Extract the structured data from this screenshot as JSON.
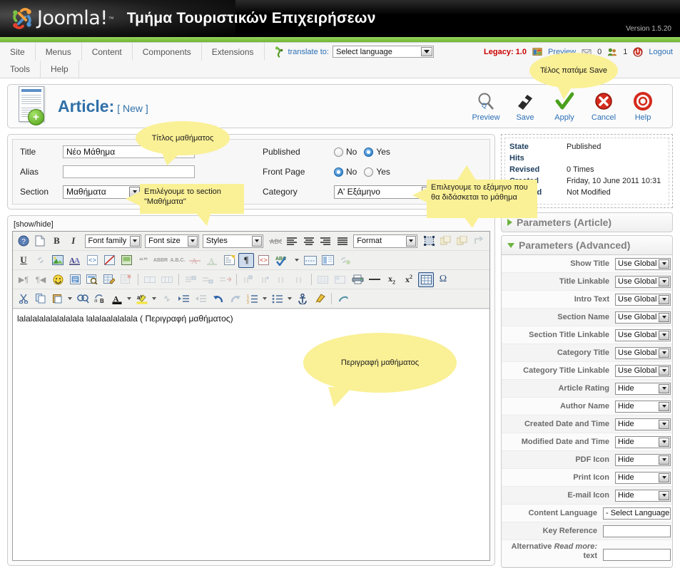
{
  "header": {
    "brand": "Joomla!",
    "brand_tm": "™",
    "site_title": "Τμήμα Τουριστικών Επιχειρήσεων",
    "version": "Version 1.5.20"
  },
  "menubar": {
    "items_row1": [
      "Site",
      "Menus",
      "Content",
      "Components",
      "Extensions"
    ],
    "items_row2": [
      "Tools",
      "Help"
    ],
    "translate_label": "translate to:",
    "translate_value": "Select language",
    "legacy": "Legacy: 1.0",
    "preview": "Preview",
    "messages_count": "0",
    "users_count": "1",
    "logout": "Logout"
  },
  "article": {
    "heading": "Article:",
    "state_tag": "[ New ]",
    "toolbar": [
      {
        "label": "Preview",
        "icon": "magnifier-icon"
      },
      {
        "label": "Save",
        "icon": "floppy-disk-icon"
      },
      {
        "label": "Apply",
        "icon": "checkmark-icon"
      },
      {
        "label": "Cancel",
        "icon": "cancel-circle-icon"
      },
      {
        "label": "Help",
        "icon": "lifering-icon"
      }
    ]
  },
  "form": {
    "title_label": "Title",
    "title_value": "Νέο Μάθημα",
    "alias_label": "Alias",
    "alias_value": "",
    "section_label": "Section",
    "section_value": "Μαθήματα",
    "published_label": "Published",
    "published_no": "No",
    "published_yes": "Yes",
    "published_selected": "Yes",
    "frontpage_label": "Front Page",
    "frontpage_no": "No",
    "frontpage_yes": "Yes",
    "frontpage_selected": "No",
    "category_label": "Category",
    "category_value": "Α' Εξάμηνο"
  },
  "editor": {
    "showhide": "[show/hide]",
    "selects": {
      "font_family": "Font family",
      "font_size": "Font size",
      "styles": "Styles",
      "format": "Format"
    },
    "content": "lalalalalalalalalala lalalaalalalala ( Περιγραφή μαθήματος)",
    "row1_icons": [
      "help-icon",
      "new-document-icon",
      "bold-icon",
      "italic-icon"
    ],
    "row1_icons_after": [
      "strikethrough-icon",
      "align-left-icon",
      "align-center-icon",
      "align-right-icon",
      "align-justify-icon"
    ],
    "row1_tail_icons": [
      "image-placeholder-icon",
      "copy-layer-icon",
      "paste-layer-icon",
      "insert-node-icon"
    ],
    "row2_icons": [
      "underline-icon",
      "unlink-icon",
      "image-tree-icon",
      "font-color-icon",
      "source-code-icon",
      "no-image-icon",
      "readmore-icon",
      "blockquote-icon",
      "abbr-icon",
      "acronym-icon",
      "del-icon",
      "ins-icon",
      "attributes-icon",
      "paragraph-marks-icon",
      "code-red-icon",
      "spellcheck-icon",
      "horizontal-rule-icon",
      "two-columns-icon",
      "anchor-link-icon"
    ],
    "row3_icons": [
      "ltr-icon",
      "rtl-icon",
      "emoticon-icon",
      "media-icon",
      "preview-icon",
      "edit-table-icon",
      "delete-table-icon",
      "merge-cells-icon",
      "split-cells-icon",
      "row-props-icon",
      "row-before-icon",
      "row-after-icon",
      "col-before-icon",
      "col-after-icon",
      "delete-row-icon",
      "delete-col-icon",
      "print-icon",
      "hr-icon",
      "subscript-icon",
      "superscript-icon",
      "table-icon",
      "special-char-icon"
    ],
    "row4_icons": [
      "cut-icon",
      "copy-icon",
      "paste-icon",
      "find-icon",
      "replace-icon",
      "text-color-icon",
      "highlight-icon",
      "unlink2-icon",
      "indent-icon",
      "outdent-icon",
      "undo-icon",
      "redo-icon",
      "ordered-list-icon",
      "unordered-list-icon",
      "anchor-icon",
      "cleanup-icon",
      "eraser-icon"
    ]
  },
  "info": {
    "rows": [
      {
        "key": "State",
        "value": "Published"
      },
      {
        "key": "Hits",
        "value": ""
      },
      {
        "key": "Revised",
        "value": "0 Times"
      },
      {
        "key": "Created",
        "value": "Friday, 10 June 2011 10:31"
      },
      {
        "key": "Modified",
        "value": "Not Modified"
      }
    ]
  },
  "params": {
    "article_head": "Parameters (Article)",
    "advanced_head": "Parameters (Advanced)",
    "rows": [
      {
        "label": "Show Title",
        "value": "Use Global",
        "type": "select"
      },
      {
        "label": "Title Linkable",
        "value": "Use Global",
        "type": "select"
      },
      {
        "label": "Intro Text",
        "value": "Use Global",
        "type": "select"
      },
      {
        "label": "Section Name",
        "value": "Use Global",
        "type": "select"
      },
      {
        "label": "Section Title Linkable",
        "value": "Use Global",
        "type": "select"
      },
      {
        "label": "Category Title",
        "value": "Use Global",
        "type": "select"
      },
      {
        "label": "Category Title Linkable",
        "value": "Use Global",
        "type": "select"
      },
      {
        "label": "Article Rating",
        "value": "Hide",
        "type": "select"
      },
      {
        "label": "Author Name",
        "value": "Hide",
        "type": "select"
      },
      {
        "label": "Created Date and Time",
        "value": "Hide",
        "type": "select"
      },
      {
        "label": "Modified Date and Time",
        "value": "Hide",
        "type": "select"
      },
      {
        "label": "PDF Icon",
        "value": "Hide",
        "type": "select"
      },
      {
        "label": "Print Icon",
        "value": "Hide",
        "type": "select"
      },
      {
        "label": "E-mail Icon",
        "value": "Hide",
        "type": "select"
      },
      {
        "label": "Content Language",
        "value": "- Select Language -",
        "type": "select-wide"
      },
      {
        "label": "Key Reference",
        "value": "",
        "type": "input"
      },
      {
        "label": "Alternative Read more: text",
        "value": "",
        "type": "input-tall"
      }
    ]
  },
  "callouts": {
    "save": "Τέλος πατάμε Save",
    "title": "Τίτλος μαθήματος",
    "section": "Επιλέγουμε το section \"Μαθήματα\"",
    "semester": "Επιλεγουμε το εξάμηνο που θα διδάσκεται το μάθημα",
    "description": "Περιγραφή μαθήματος"
  },
  "colors": {
    "green": "#7ac143",
    "link_blue": "#2b6fb5",
    "title_blue": "#2f6fa8",
    "callout_yellow": "#faf096",
    "legacy_red": "#cc0000"
  }
}
